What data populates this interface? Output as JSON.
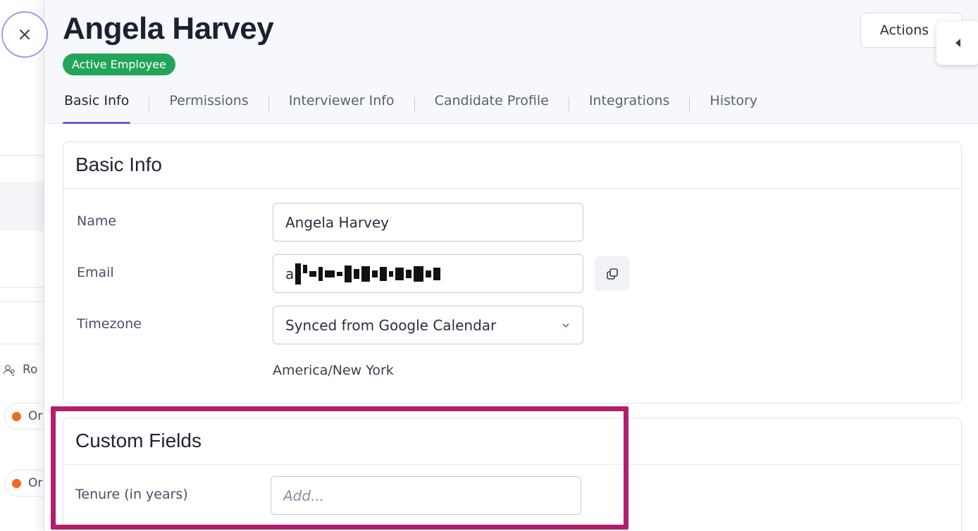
{
  "background": {
    "row_label": "Ro",
    "pill_1_text": "Or",
    "pill_2_text": "Or",
    "status_color": "#f26b21"
  },
  "drawer": {
    "employee_name": "Angela Harvey",
    "status_badge": "Active Employee",
    "status_color": "#23a559",
    "actions_label": "Actions",
    "tabs": [
      {
        "label": "Basic Info",
        "active": true
      },
      {
        "label": "Permissions",
        "active": false
      },
      {
        "label": "Interviewer Info",
        "active": false
      },
      {
        "label": "Candidate Profile",
        "active": false
      },
      {
        "label": "Integrations",
        "active": false
      },
      {
        "label": "History",
        "active": false
      }
    ],
    "accent_color": "#6b5fd3"
  },
  "basic_info": {
    "title": "Basic Info",
    "name_label": "Name",
    "name_value": "Angela Harvey",
    "email_label": "Email",
    "email_visible_prefix": "a",
    "timezone_label": "Timezone",
    "timezone_value": "Synced from Google Calendar",
    "timezone_note": "America/New York"
  },
  "custom_fields": {
    "title": "Custom Fields",
    "tenure_label": "Tenure (in years)",
    "tenure_placeholder": "Add...",
    "highlight_color": "#b21e6b"
  }
}
